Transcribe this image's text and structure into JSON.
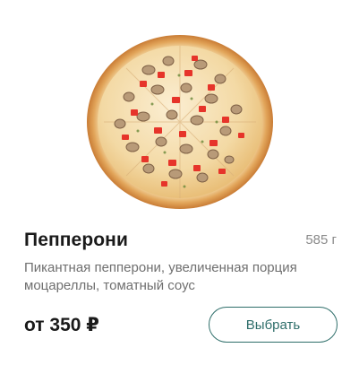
{
  "product": {
    "name": "Пепперони",
    "weight": "585 г",
    "description": "Пикантная пепперони, увеличенная порция моцареллы, томатный соус",
    "price": "от 350 ₽",
    "button_label": "Выбрать",
    "image_icon": "pizza-image"
  },
  "colors": {
    "accent": "#2e6e6a",
    "title": "#1a1a1a",
    "muted": "#6f6f6f",
    "weight": "#8a8a8a"
  }
}
